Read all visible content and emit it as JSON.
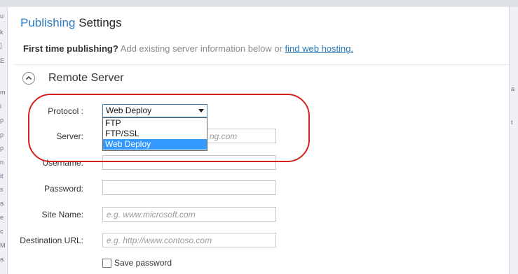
{
  "header": {
    "title_accent": "Publishing",
    "title_rest": "Settings",
    "hint_bold": "First time publishing?",
    "hint_text": "Add existing server information below or",
    "hint_link": "find web hosting."
  },
  "section": {
    "title": "Remote Server",
    "toggle_icon": "chevron-up-icon"
  },
  "protocol": {
    "label": "Protocol :",
    "selected": "Web Deploy",
    "options": [
      "FTP",
      "FTP/SSL",
      "Web Deploy"
    ]
  },
  "server": {
    "label": "Server:",
    "placeholder_tail": "ng.com"
  },
  "username": {
    "label": "Username:",
    "value": ""
  },
  "password": {
    "label": "Password:",
    "value": ""
  },
  "site_name": {
    "label": "Site Name:",
    "placeholder": "e.g. www.microsoft.com"
  },
  "destination_url": {
    "label": "Destination URL:",
    "placeholder": "e.g. http://www.contoso.com"
  },
  "save_password": {
    "label": "Save password",
    "checked": false
  },
  "colors": {
    "accent": "#2e7bbf",
    "highlight": "#3399ff",
    "annotation": "#d42020"
  }
}
